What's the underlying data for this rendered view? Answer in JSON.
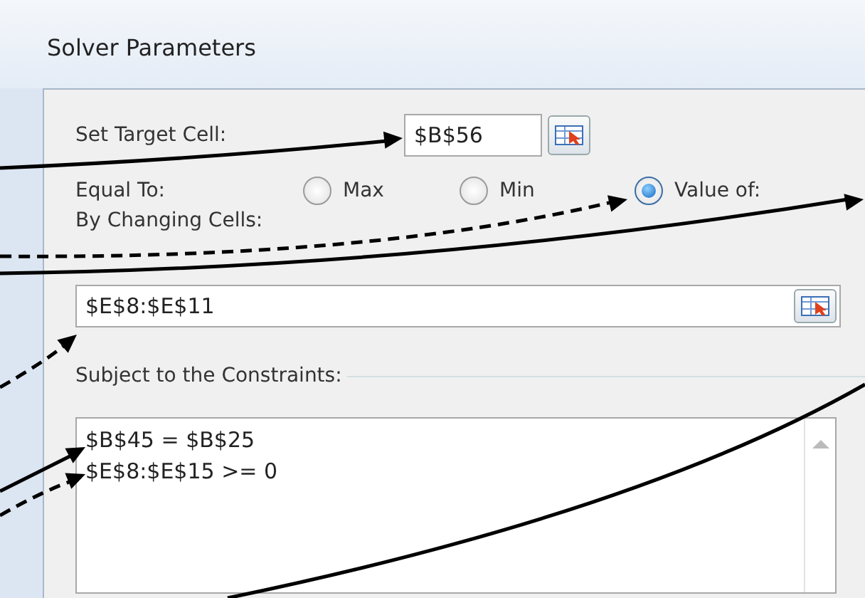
{
  "window": {
    "title": "Solver Parameters"
  },
  "target_cell": {
    "label": "Set Target Cell:",
    "value": "$B$56"
  },
  "equal_to": {
    "label": "Equal To:",
    "options": [
      {
        "label": "Max",
        "selected": false
      },
      {
        "label": "Min",
        "selected": false
      },
      {
        "label": "Value of:",
        "selected": true
      }
    ]
  },
  "changing_cells": {
    "label": "By Changing Cells:",
    "value": "$E$8:$E$11"
  },
  "constraints": {
    "label": "Subject to the Constraints:",
    "items": [
      "$B$45 = $B$25",
      "$E$8:$E$15 >= 0"
    ]
  }
}
